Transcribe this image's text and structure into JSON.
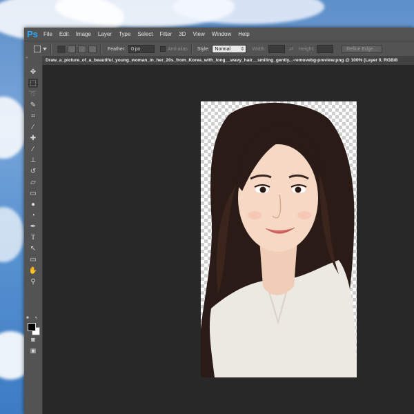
{
  "app": {
    "logo": "Ps",
    "menu": [
      "File",
      "Edit",
      "Image",
      "Layer",
      "Type",
      "Select",
      "Filter",
      "3D",
      "View",
      "Window",
      "Help"
    ]
  },
  "options": {
    "feather_label": "Feather:",
    "feather_value": "0 px",
    "antialias_label": "Anti-alias",
    "style_label": "Style:",
    "style_value": "Normal",
    "width_label": "Width:",
    "height_label": "Height:",
    "refine_edge_label": "Refine Edge..."
  },
  "document": {
    "tab_title": "Draw_a_picture_of_a_beautiful_young_woman_in_her_20s_from_Korea_with_long__wavy_hair__smiling_gently...-removebg-preview.png @ 100% (Layer 0, RGB/8"
  },
  "toolbar": {
    "collapse_glyph": "»",
    "tools": [
      {
        "name": "move-tool-icon",
        "glyph": "✥"
      },
      {
        "name": "marquee-tool-icon",
        "glyph": "⬚"
      },
      {
        "name": "lasso-tool-icon",
        "glyph": "➰"
      },
      {
        "name": "quick-select-tool-icon",
        "glyph": "✎"
      },
      {
        "name": "crop-tool-icon",
        "glyph": "⌗"
      },
      {
        "name": "eyedropper-tool-icon",
        "glyph": "⁄"
      },
      {
        "name": "healing-brush-tool-icon",
        "glyph": "✚"
      },
      {
        "name": "brush-tool-icon",
        "glyph": "⁄"
      },
      {
        "name": "clone-stamp-tool-icon",
        "glyph": "⊥"
      },
      {
        "name": "history-brush-tool-icon",
        "glyph": "↺"
      },
      {
        "name": "eraser-tool-icon",
        "glyph": "▱"
      },
      {
        "name": "gradient-tool-icon",
        "glyph": "▭"
      },
      {
        "name": "blur-tool-icon",
        "glyph": "●"
      },
      {
        "name": "dodge-tool-icon",
        "glyph": "◔"
      },
      {
        "name": "pen-tool-icon",
        "glyph": "✒"
      },
      {
        "name": "type-tool-icon",
        "glyph": "T"
      },
      {
        "name": "path-select-tool-icon",
        "glyph": "↖"
      },
      {
        "name": "shape-tool-icon",
        "glyph": "▭"
      },
      {
        "name": "hand-tool-icon",
        "glyph": "✋"
      },
      {
        "name": "zoom-tool-icon",
        "glyph": "⚲"
      }
    ],
    "quick_mask_glyph": "◙",
    "screen_mode_glyph": "▣"
  },
  "colors": {
    "foreground": "#000000",
    "background": "#ffffff",
    "accent": "#31a8ff"
  }
}
